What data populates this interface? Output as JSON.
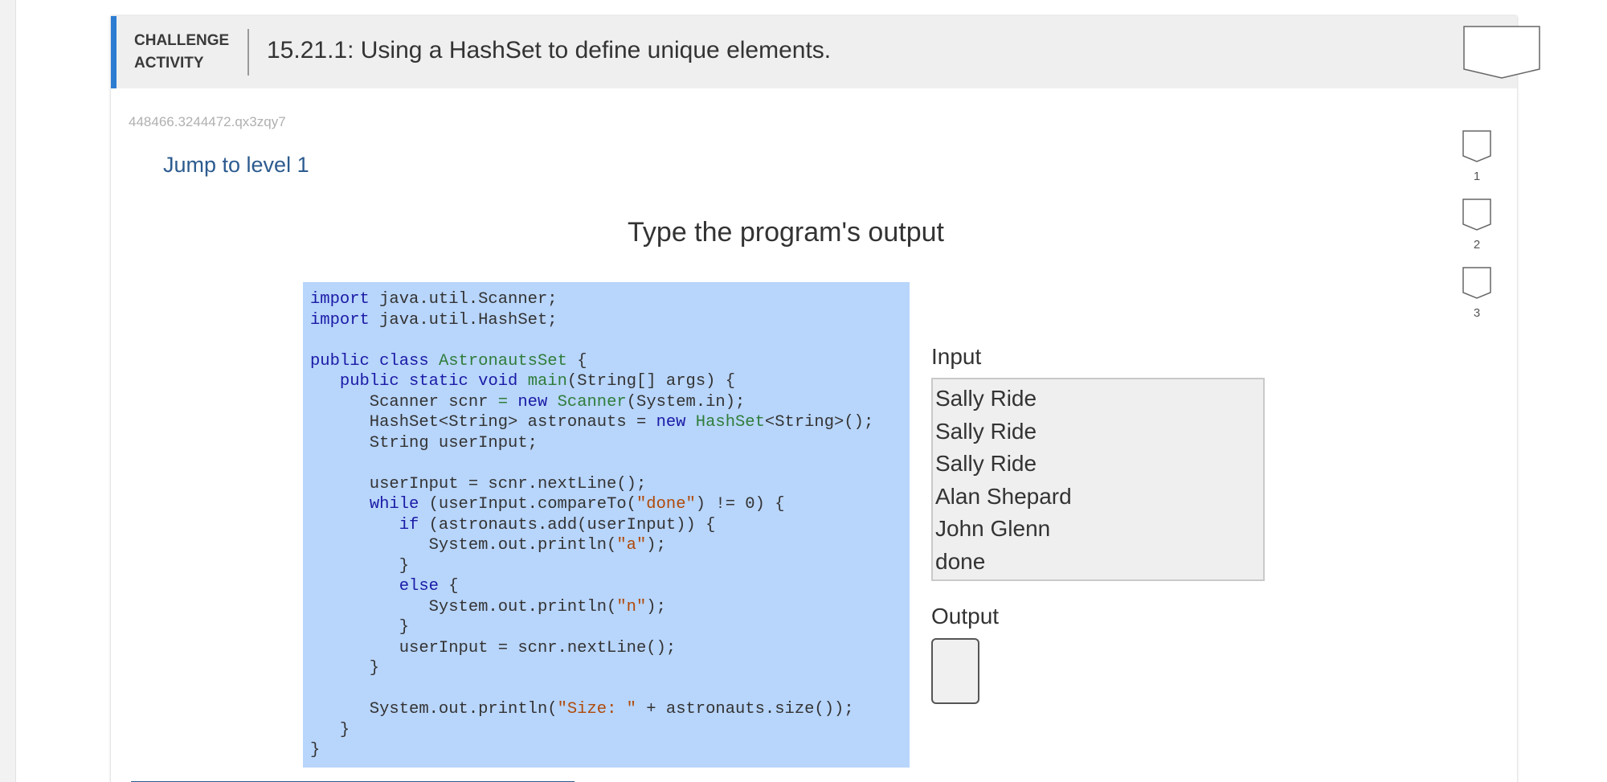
{
  "header": {
    "label_line1": "CHALLENGE",
    "label_line2": "ACTIVITY",
    "title": "15.21.1: Using a HashSet to define unique elements."
  },
  "activity_id": "448466.3244472.qx3zqy7",
  "jump_link": "Jump to level 1",
  "instruction": "Type the program's output",
  "code": {
    "l1a": "import",
    "l1b": " java.util.Scanner;",
    "l2a": "import",
    "l2b": " java.util.HashSet;",
    "l4a": "public",
    "l4b": " ",
    "l4c": "class",
    "l4d": " ",
    "l4e": "AstronautsSet",
    "l4f": " {",
    "l5a": "   ",
    "l5b": "public",
    "l5c": " ",
    "l5d": "static",
    "l5e": " ",
    "l5f": "void",
    "l5g": " ",
    "l5h": "main",
    "l5i": "(String[] args) {",
    "l6a": "      Scanner scnr ",
    "l6b": "=",
    "l6c": " ",
    "l6d": "new",
    "l6e": " ",
    "l6f": "Scanner",
    "l6g": "(System.in);",
    "l7a": "      HashSet<String> astronauts = ",
    "l7b": "new",
    "l7c": " ",
    "l7d": "HashSet",
    "l7e": "<String>();",
    "l8": "      String userInput;",
    "l10": "      userInput = scnr.nextLine();",
    "l11a": "      ",
    "l11b": "while",
    "l11c": " (userInput.compareTo(",
    "l11d": "\"done\"",
    "l11e": ") != 0) {",
    "l12a": "         ",
    "l12b": "if",
    "l12c": " (astronauts.add(userInput)) {",
    "l13a": "            System.out.println(",
    "l13b": "\"a\"",
    "l13c": ");",
    "l14": "         }",
    "l15a": "         ",
    "l15b": "else",
    "l15c": " {",
    "l16a": "            System.out.println(",
    "l16b": "\"n\"",
    "l16c": ");",
    "l17": "         }",
    "l18": "         userInput = scnr.nextLine();",
    "l19": "      }",
    "l21a": "      System.out.println(",
    "l21b": "\"Size: \"",
    "l21c": " + astronauts.size());",
    "l22": "   }",
    "l23": "}"
  },
  "io": {
    "input_label": "Input",
    "input_lines": [
      "Sally Ride",
      "Sally Ride",
      "Sally Ride",
      "Alan Shepard",
      "John Glenn",
      "done"
    ],
    "output_label": "Output"
  },
  "levels": [
    "1",
    "2",
    "3"
  ],
  "colors": {
    "accent": "#2c7cd2",
    "code_bg": "#b8d5fb",
    "keyword": "#1a1aa6",
    "class_name": "#2f7d3a",
    "string": "#b04a0a",
    "link": "#2c5b8f"
  }
}
